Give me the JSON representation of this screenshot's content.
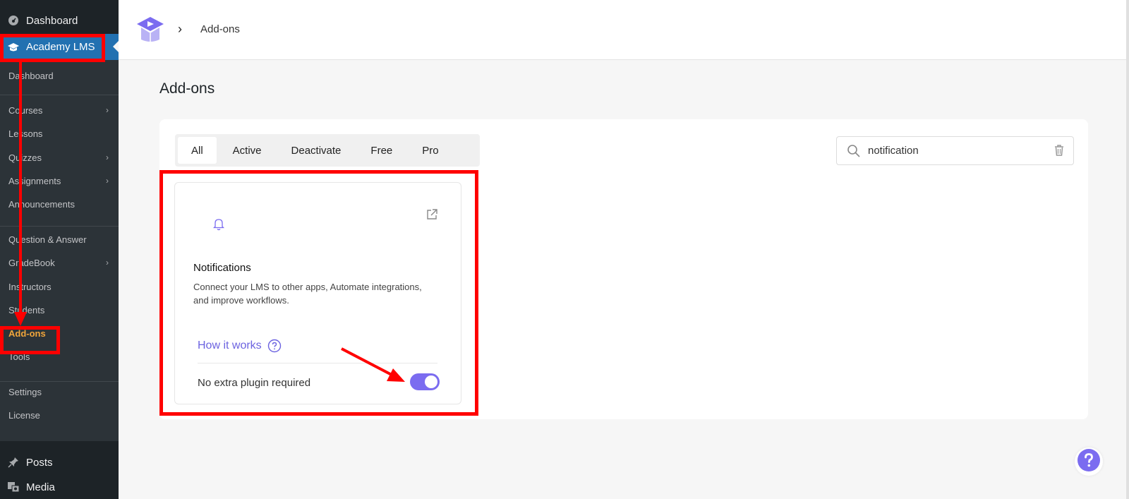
{
  "sidebar": {
    "top_item": "Dashboard",
    "active_item": "Academy LMS",
    "submenu": [
      {
        "label": "Dashboard",
        "chevron": false
      },
      {
        "label": "Courses",
        "chevron": true
      },
      {
        "label": "Lessons",
        "chevron": false
      },
      {
        "label": "Quizzes",
        "chevron": true
      },
      {
        "label": "Assignments",
        "chevron": true
      },
      {
        "label": "Announcements",
        "chevron": false
      },
      {
        "label": "Question & Answer",
        "chevron": false
      },
      {
        "label": "GradeBook",
        "chevron": true
      },
      {
        "label": "Instructors",
        "chevron": false
      },
      {
        "label": "Students",
        "chevron": false
      },
      {
        "label": "Add-ons",
        "chevron": false
      },
      {
        "label": "Tools",
        "chevron": false
      },
      {
        "label": "Settings",
        "chevron": false
      },
      {
        "label": "License",
        "chevron": false
      }
    ],
    "bottom_items": [
      "Posts",
      "Media"
    ],
    "chevron_glyph": "›"
  },
  "breadcrumb": {
    "separator": "›",
    "current": "Add-ons"
  },
  "page": {
    "title": "Add-ons"
  },
  "tabs": [
    "All",
    "Active",
    "Deactivate",
    "Free",
    "Pro"
  ],
  "search": {
    "value": "notification"
  },
  "card": {
    "title": "Notifications",
    "description": "Connect your LMS to other apps, Automate integrations, and improve workflows.",
    "how_it_works": "How it works",
    "footer_text": "No extra plugin required",
    "enabled": true
  },
  "colors": {
    "accent": "#7b6cf0",
    "annotation": "#ff0000",
    "wp_active": "#2271b1",
    "current_submenu": "#f0a63b"
  }
}
